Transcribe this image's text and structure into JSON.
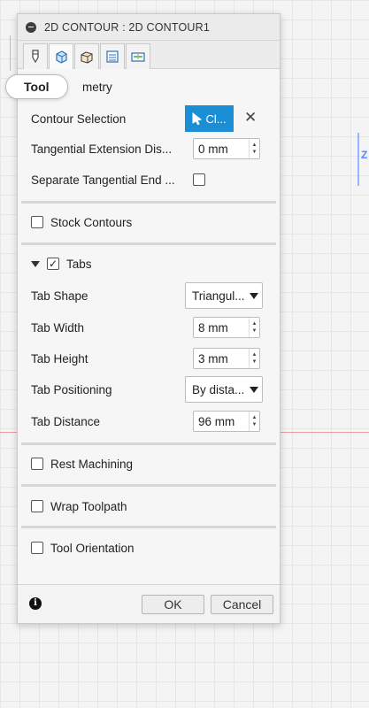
{
  "panel": {
    "title": "2D CONTOUR : 2D CONTOUR1",
    "tabs": [
      {
        "name": "tool-tab-icon"
      },
      {
        "name": "geometry-tab-icon"
      },
      {
        "name": "heights-tab-icon"
      },
      {
        "name": "passes-tab-icon"
      },
      {
        "name": "linking-tab-icon"
      }
    ],
    "tooltip": "Tool",
    "section_header": "metry"
  },
  "geometry": {
    "contour_selection_label": "Contour Selection",
    "contour_selection_button": "Cl...",
    "tangential_ext_label": "Tangential Extension Dis...",
    "tangential_ext_value": "0 mm",
    "separate_tangential_label": "Separate Tangential End ..."
  },
  "stock_contours": {
    "label": "Stock Contours"
  },
  "tabs_section": {
    "label": "Tabs",
    "tab_shape_label": "Tab Shape",
    "tab_shape_value": "Triangul...",
    "tab_width_label": "Tab Width",
    "tab_width_value": "8 mm",
    "tab_height_label": "Tab Height",
    "tab_height_value": "3 mm",
    "tab_positioning_label": "Tab Positioning",
    "tab_positioning_value": "By dista...",
    "tab_distance_label": "Tab Distance",
    "tab_distance_value": "96 mm"
  },
  "rest_machining": {
    "label": "Rest Machining"
  },
  "wrap_toolpath": {
    "label": "Wrap Toolpath"
  },
  "tool_orientation": {
    "label": "Tool Orientation"
  },
  "footer": {
    "ok": "OK",
    "cancel": "Cancel",
    "info_icon": "i"
  },
  "viewport": {
    "axis_z_label": "Z"
  }
}
